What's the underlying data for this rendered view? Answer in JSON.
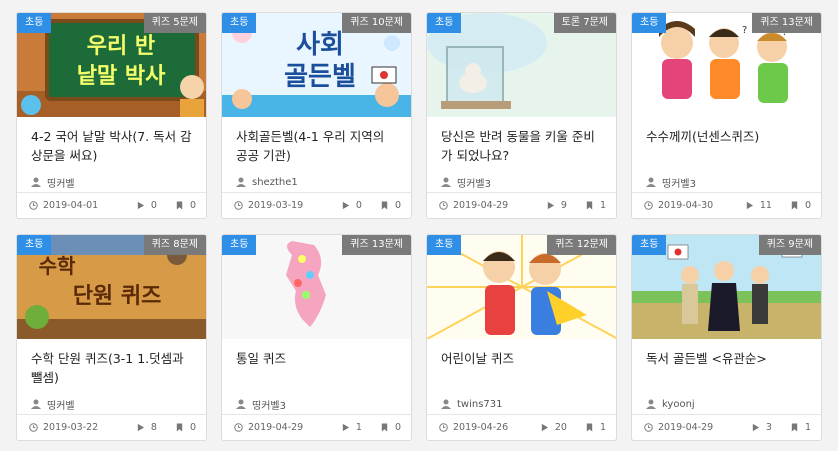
{
  "cards": [
    {
      "level": "초등",
      "count": "퀴즈 5문제",
      "title": "4-2 국어 낱말 박사(7. 독서 감상문을 써요)",
      "author": "띵커벨",
      "date": "2019-04-01",
      "plays": "0",
      "saves": "0",
      "thumb_text": [
        "우리 반",
        "낱말 박사"
      ]
    },
    {
      "level": "초등",
      "count": "퀴즈 10문제",
      "title": "사회골든벨(4-1 우리 지역의 공공 기관)",
      "author": "shezthe1",
      "date": "2019-03-19",
      "plays": "0",
      "saves": "0",
      "thumb_text": [
        "사회",
        "골든벨"
      ]
    },
    {
      "level": "초등",
      "count": "토론 7문제",
      "title": "당신은 반려 동물을 키울 준비가 되었나요?",
      "author": "띵커벨3",
      "date": "2019-04-29",
      "plays": "9",
      "saves": "1",
      "thumb_text": []
    },
    {
      "level": "초등",
      "count": "퀴즈 13문제",
      "title": "수수께끼(넌센스퀴즈)",
      "author": "띵커벨3",
      "date": "2019-04-30",
      "plays": "11",
      "saves": "0",
      "thumb_text": []
    },
    {
      "level": "초등",
      "count": "퀴즈 8문제",
      "title": "수학 단원 퀴즈(3-1 1.덧셈과 뺄셈)",
      "author": "띵커벨",
      "date": "2019-03-22",
      "plays": "8",
      "saves": "0",
      "thumb_text": [
        "수학",
        "단원 퀴즈"
      ]
    },
    {
      "level": "초등",
      "count": "퀴즈 13문제",
      "title": "통일 퀴즈",
      "author": "띵커벨3",
      "date": "2019-04-29",
      "plays": "1",
      "saves": "0",
      "thumb_text": []
    },
    {
      "level": "초등",
      "count": "퀴즈 12문제",
      "title": "어린이날 퀴즈",
      "author": "twins731",
      "date": "2019-04-26",
      "plays": "20",
      "saves": "1",
      "thumb_text": []
    },
    {
      "level": "초등",
      "count": "퀴즈 9문제",
      "title": "독서 골든벨 <유관순>",
      "author": "kyoonj",
      "date": "2019-04-29",
      "plays": "3",
      "saves": "1",
      "thumb_text": []
    }
  ],
  "colors": {
    "level_badge": "#2f8fe6",
    "count_badge": "#7a7a7a"
  },
  "icons": {
    "author": "user-icon",
    "date": "clock-icon",
    "plays": "play-icon",
    "saves": "bookmark-icon"
  }
}
